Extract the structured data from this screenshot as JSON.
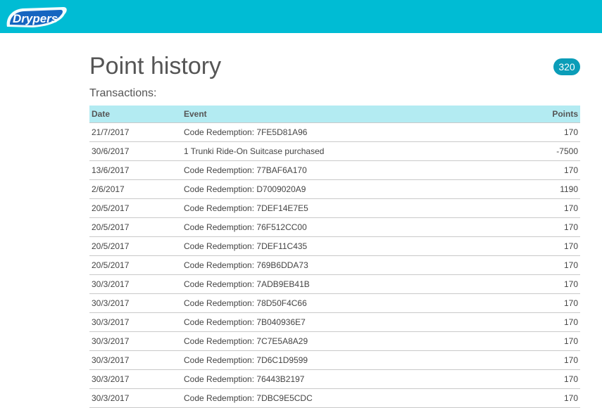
{
  "brand": {
    "logo_text": "Drypers",
    "accent": "#00bcd4",
    "badge_color": "#0b9db8",
    "header_row_color": "#b3ebf2"
  },
  "page": {
    "title": "Point history",
    "points_balance": "320",
    "subheading": "Transactions:"
  },
  "table": {
    "columns": [
      "Date",
      "Event",
      "Points"
    ],
    "rows": [
      [
        "21/7/2017",
        "Code Redemption: 7FE5D81A96",
        "170"
      ],
      [
        "30/6/2017",
        "1 Trunki Ride-On Suitcase purchased",
        "-7500"
      ],
      [
        "13/6/2017",
        "Code Redemption: 77BAF6A170",
        "170"
      ],
      [
        "2/6/2017",
        "Code Redemption: D7009020A9",
        "1190"
      ],
      [
        "20/5/2017",
        "Code Redemption: 7DEF14E7E5",
        "170"
      ],
      [
        "20/5/2017",
        "Code Redemption: 76F512CC00",
        "170"
      ],
      [
        "20/5/2017",
        "Code Redemption: 7DEF11C435",
        "170"
      ],
      [
        "20/5/2017",
        "Code Redemption: 769B6DDA73",
        "170"
      ],
      [
        "30/3/2017",
        "Code Redemption: 7ADB9EB41B",
        "170"
      ],
      [
        "30/3/2017",
        "Code Redemption: 78D50F4C66",
        "170"
      ],
      [
        "30/3/2017",
        "Code Redemption: 7B040936E7",
        "170"
      ],
      [
        "30/3/2017",
        "Code Redemption: 7C7E5A8A29",
        "170"
      ],
      [
        "30/3/2017",
        "Code Redemption: 7D6C1D9599",
        "170"
      ],
      [
        "30/3/2017",
        "Code Redemption: 76443B2197",
        "170"
      ],
      [
        "30/3/2017",
        "Code Redemption: 7DBC9E5CDC",
        "170"
      ]
    ]
  }
}
